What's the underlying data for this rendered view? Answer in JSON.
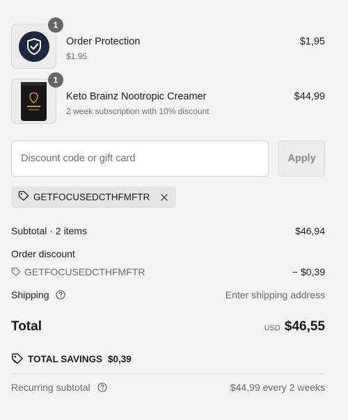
{
  "line_items": [
    {
      "name": "Order Protection",
      "subtitle": "$1.95",
      "price": "$1,95",
      "quantity": "1",
      "image_icon": "shield-check-icon"
    },
    {
      "name": "Keto Brainz Nootropic Creamer",
      "subtitle": "2 week subscription with 10% discount",
      "price": "$44,99",
      "quantity": "1",
      "image_icon": "product-bag-image"
    }
  ],
  "discount": {
    "placeholder": "Discount code or gift card",
    "value": "",
    "apply_label": "Apply",
    "applied_code": "GETFOCUSEDCTHFMFTR"
  },
  "summary": {
    "subtotal_label": "Subtotal · 2 items",
    "subtotal_value": "$46,94",
    "order_discount_label": "Order discount",
    "order_discount_code": "GETFOCUSEDCTHFMFTR",
    "order_discount_value": "− $0,39",
    "shipping_label": "Shipping",
    "shipping_value": "Enter shipping address",
    "total_label": "Total",
    "total_currency": "USD",
    "total_value": "$46,55",
    "savings_label": "TOTAL SAVINGS",
    "savings_value": "$0,39",
    "recurring_label": "Recurring subtotal",
    "recurring_value": "$44,99 every 2 weeks"
  },
  "colors": {
    "background": "#f4f4f4",
    "badge": "#666666",
    "shield_bg": "#1d2840",
    "chip_bg": "#e4e4e4"
  }
}
